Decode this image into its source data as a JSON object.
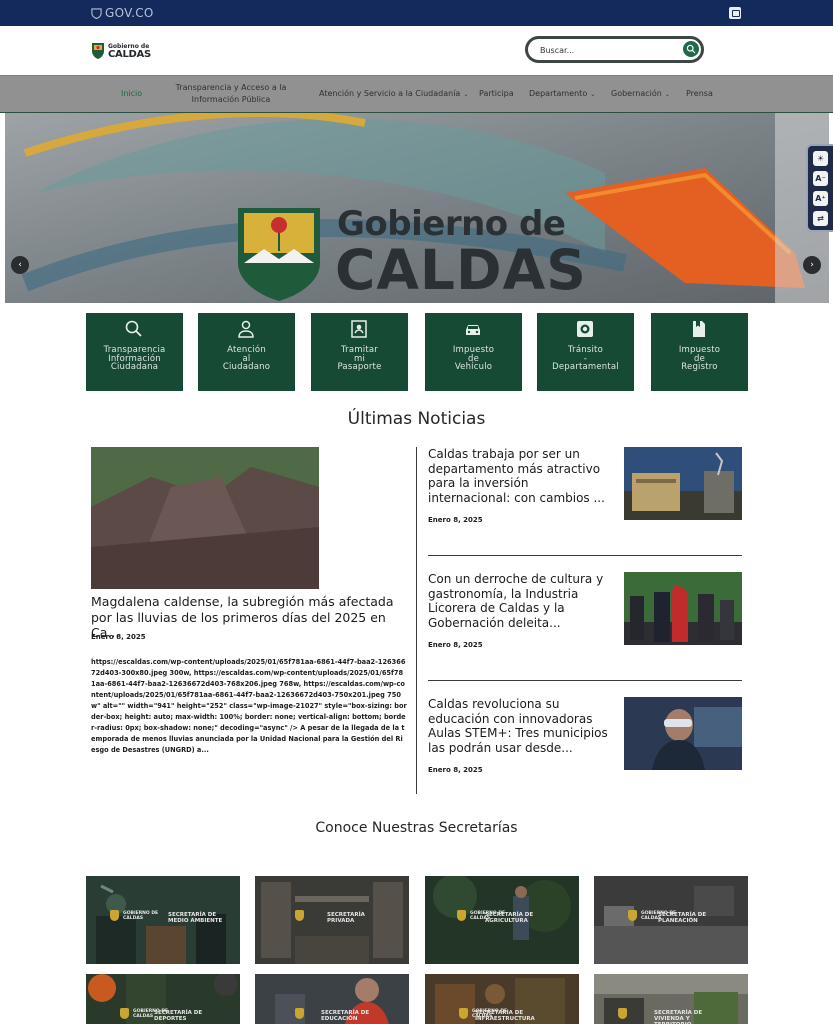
{
  "gov_bar": {
    "label": "GOV.CO"
  },
  "header": {
    "logo_line1": "Gobierno de",
    "logo_line2": "CALDAS",
    "search_placeholder": "Buscar..."
  },
  "nav": {
    "items": [
      {
        "label": "Inicio"
      },
      {
        "label": "Transparencia y Acceso a la",
        "label2": "Información Pública"
      },
      {
        "label": "Atención y Servicio a la Ciudadanía"
      },
      {
        "label": "Participa"
      },
      {
        "label": "Departamento"
      },
      {
        "label": "Gobernación"
      },
      {
        "label": "Prensa"
      }
    ]
  },
  "hero": {
    "title_line1": "Gobierno de",
    "title_line2": "CALDAS",
    "prev": "‹",
    "next": "›"
  },
  "a11y": {
    "contrast": "☀",
    "text_decrease": "A⁻",
    "text_increase": "A⁺",
    "reader": "⇄"
  },
  "quick_links": [
    {
      "l1": "Transparencia",
      "l2": "Información",
      "l3": "Ciudadana",
      "icon": "search-icon"
    },
    {
      "l1": "Atención",
      "l2": "al",
      "l3": "Ciudadano",
      "icon": "person-icon"
    },
    {
      "l1": "Tramitar",
      "l2": "mi",
      "l3": "Pasaporte",
      "icon": "passport-icon"
    },
    {
      "l1": "Impuesto",
      "l2": "de",
      "l3": "Vehículo",
      "icon": "car-icon"
    },
    {
      "l1": "Tránsito",
      "l2": "-",
      "l3": "Departamental",
      "icon": "traffic-icon"
    },
    {
      "l1": "Impuesto",
      "l2": "de",
      "l3": "Registro",
      "icon": "document-icon"
    }
  ],
  "news": {
    "heading": "Últimas Noticias",
    "main": {
      "title": "Magdalena caldense, la subregión más afectada por las lluvias de los primeros días del 2025 en Ca...",
      "date": "Enero 8, 2025",
      "excerpt": "https://escaldas.com/wp-content/uploads/2025/01/65f781aa-6861-44f7-baa2-12636672d403-300x80.jpeg 300w, https://escaldas.com/wp-content/uploads/2025/01/65f781aa-6861-44f7-baa2-12636672d403-768x206.jpeg 768w, https://escaldas.com/wp-content/uploads/2025/01/65f781aa-6861-44f7-baa2-12636672d403-750x201.jpeg 750w\" alt=\"\" width=\"941\" height=\"252\" class=\"wp-image-21027\" style=\"box-sizing: border-box; height: auto; max-width: 100%; border: none; vertical-align: bottom; border-radius: 0px; box-shadow: none;\" decoding=\"async\" /> A pesar de la llegada de la temporada de menos lluvias anunciada por la Unidad Nacional para la Gestión del Riesgo de Desastres (UNGRD) a..."
    },
    "side": [
      {
        "title": "Caldas trabaja por ser un departamento más atractivo para la inversión internacional: con cambios ...",
        "date": "Enero 8, 2025"
      },
      {
        "title": "Con un derroche de cultura y gastronomía, la Industria Licorera de Caldas y la Gobernación deleita...",
        "date": "Enero 8, 2025"
      },
      {
        "title": "Caldas revoluciona su educación con innovadoras Aulas STEM+: Tres municipios las podrán usar desde...",
        "date": "Enero 8, 2025"
      }
    ]
  },
  "secretarias": {
    "heading": "Conoce Nuestras Secretarías",
    "badge_line1": "GOBIERNO DE",
    "badge_line2": "CALDAS",
    "items": [
      {
        "name": "Secretaría de Medio Ambiente"
      },
      {
        "name": "Secretaría Privada"
      },
      {
        "name": "Secretaría de Agricultura"
      },
      {
        "name": "Secretaría de Planeación"
      },
      {
        "name": "Secretaría de Deportes"
      },
      {
        "name": "Secretaría de Educación"
      },
      {
        "name": "Secretaría de Infraestructura"
      },
      {
        "name": "Secretaría de Vivienda y Territorio"
      }
    ]
  }
}
